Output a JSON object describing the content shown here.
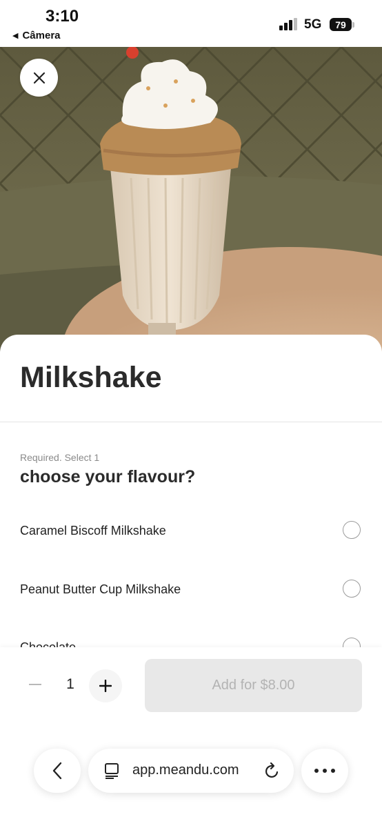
{
  "status_bar": {
    "time": "3:10",
    "back_app": "Câmera",
    "network": "5G",
    "battery": "79"
  },
  "product": {
    "title": "Milkshake",
    "image_alt": "Milkshake"
  },
  "option_group": {
    "requirement": "Required. Select 1",
    "question": "choose your flavour?",
    "options": [
      {
        "label": "Caramel Biscoff Milkshake",
        "selected": false
      },
      {
        "label": "Peanut Butter Cup Milkshake",
        "selected": false
      },
      {
        "label": "Chocolate",
        "selected": false
      }
    ]
  },
  "order": {
    "quantity": "1",
    "add_button": "Add for $8.00"
  },
  "browser": {
    "url": "app.meandu.com"
  },
  "colors": {
    "add_button_bg": "#e8e8e8",
    "add_button_text": "#b3b3b3",
    "title_text": "#2b2b2b"
  }
}
